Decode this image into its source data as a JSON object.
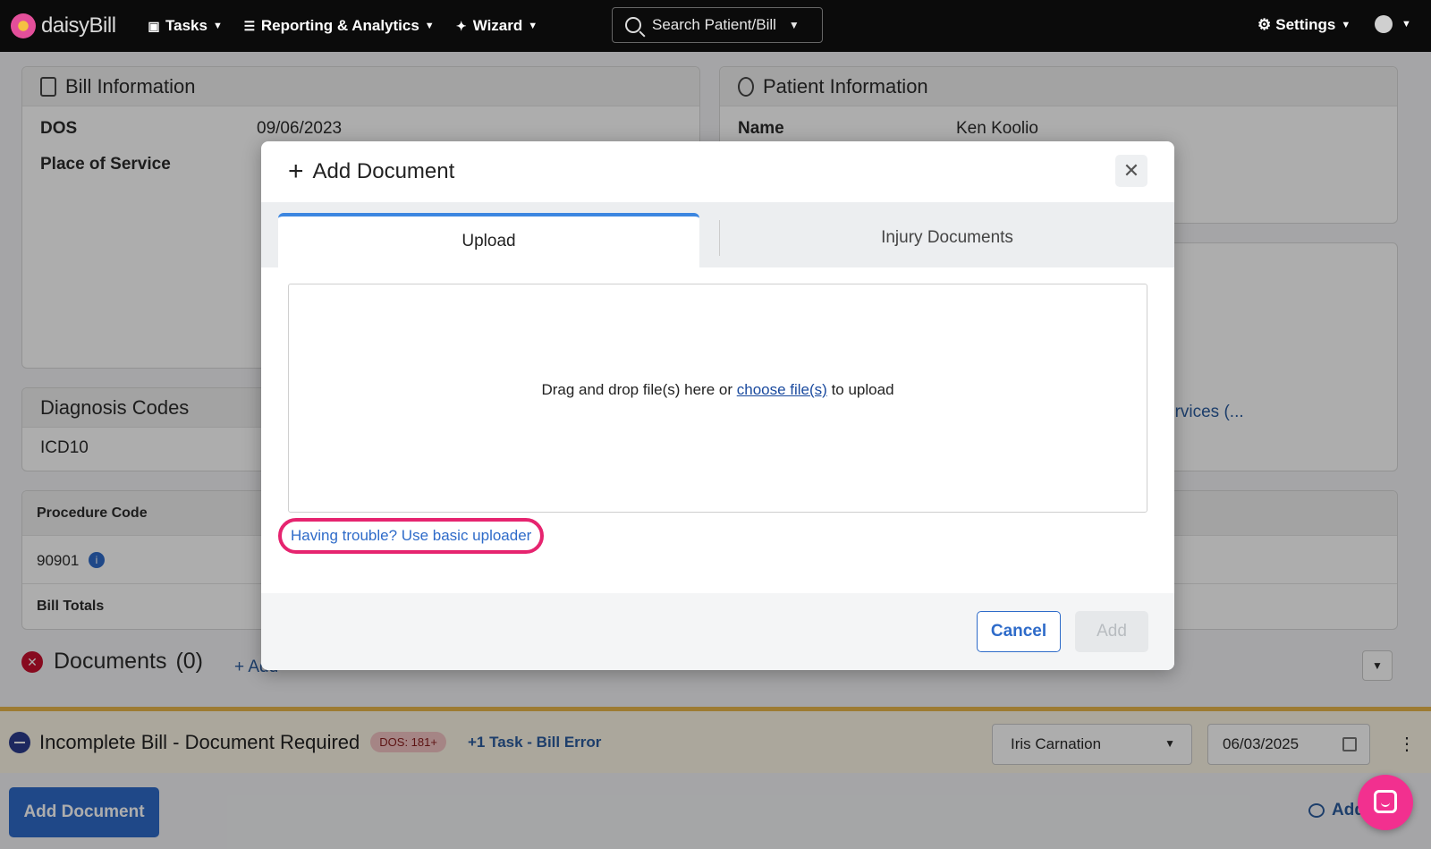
{
  "nav": {
    "brand": "daisyBill",
    "items": [
      {
        "label": "Tasks",
        "icon": "clipboard-icon"
      },
      {
        "label": "Reporting & Analytics",
        "icon": "chart-icon"
      },
      {
        "label": "Wizard",
        "icon": "wand-icon"
      }
    ],
    "search_label": "Search Patient/Bill",
    "settings_label": "Settings"
  },
  "bill_info": {
    "title": "Bill Information",
    "dos_label": "DOS",
    "dos_value": "09/06/2023",
    "pos_label": "Place of Service"
  },
  "patient_info": {
    "title": "Patient Information",
    "name_label": "Name",
    "name_value": "Ken Koolio",
    "partial_link": "ervices (..."
  },
  "diagnosis": {
    "title": "Diagnosis Codes",
    "icd_label": "ICD10"
  },
  "procedure": {
    "header": "Procedure Code",
    "code": "90901",
    "totals_label": "Bill Totals"
  },
  "documents": {
    "title": "Documents",
    "count": "(0)",
    "add_label": "+ Add"
  },
  "status": {
    "title": "Incomplete Bill - Document Required",
    "badge": "DOS: 181+",
    "task_link": "+1 Task - Bill Error",
    "assignee": "Iris Carnation",
    "date": "06/03/2025"
  },
  "footer": {
    "add_document": "Add Document",
    "add_note": "Add"
  },
  "modal": {
    "title": "Add Document",
    "tabs": [
      "Upload",
      "Injury Documents"
    ],
    "drop_text_before": "Drag and drop file(s) here or ",
    "drop_link": "choose file(s)",
    "drop_text_after": " to upload",
    "basic_uploader_link": "Having trouble? Use basic uploader",
    "cancel_label": "Cancel",
    "add_label": "Add"
  },
  "colors": {
    "accent": "#2e6bc9",
    "highlight": "#e6246f",
    "nav_bg": "#0b0b0b",
    "status_border": "#e8b64b"
  }
}
